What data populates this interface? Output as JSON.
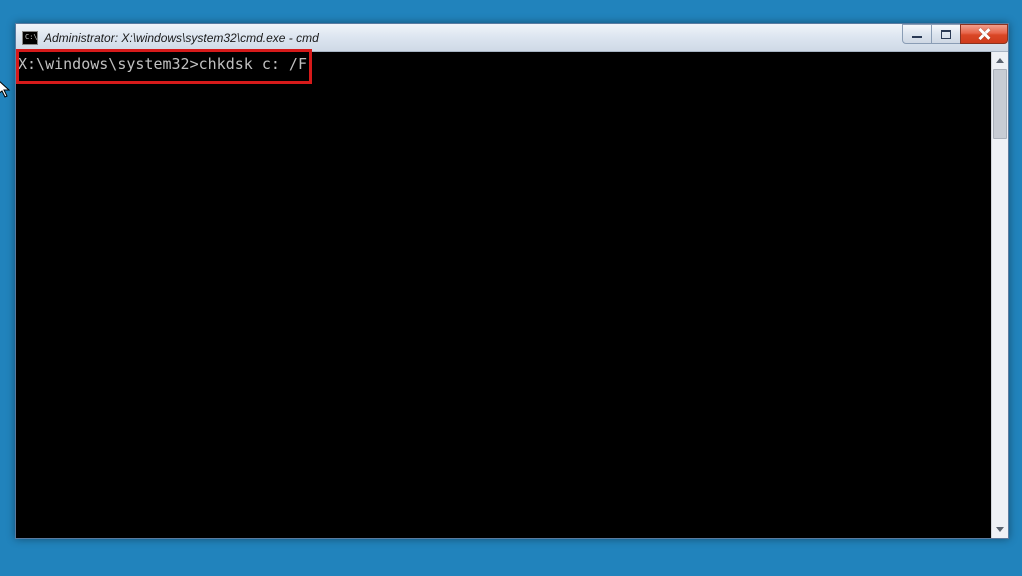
{
  "window": {
    "title": "Administrator: X:\\windows\\system32\\cmd.exe - cmd",
    "icon_label": "C:\\"
  },
  "console": {
    "prompt": "X:\\windows\\system32>",
    "command": "chkdsk c: /F"
  },
  "controls": {
    "minimize": "Minimize",
    "maximize": "Maximize",
    "close": "Close"
  },
  "annotation": {
    "highlight_color": "#d61a1a"
  }
}
